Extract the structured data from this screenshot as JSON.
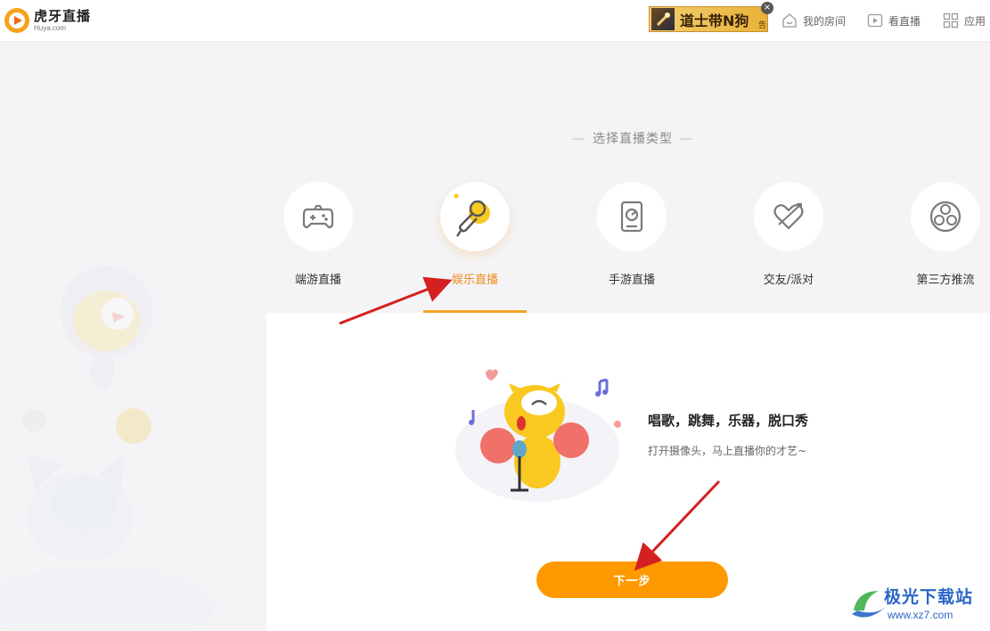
{
  "app": {
    "logo_cn": "虎牙直播",
    "logo_en": "Huya.com"
  },
  "header": {
    "ad_text": "道士带N狗",
    "ad_tag": "告",
    "ad_close": "×",
    "nav": [
      {
        "label": "我的房间",
        "icon": "house-icon"
      },
      {
        "label": "看直播",
        "icon": "play-icon"
      },
      {
        "label": "应用",
        "icon": "apps-grid-icon"
      }
    ]
  },
  "section": {
    "title": "选择直播类型"
  },
  "categories": [
    {
      "label": "端游直播",
      "icon": "gamepad-icon",
      "selected": false
    },
    {
      "label": "娱乐直播",
      "icon": "microphone-icon",
      "selected": true
    },
    {
      "label": "手游直播",
      "icon": "mobile-game-icon",
      "selected": false
    },
    {
      "label": "交友/派对",
      "icon": "heart-arrow-icon",
      "selected": false
    },
    {
      "label": "第三方推流",
      "icon": "obs-icon",
      "selected": false
    }
  ],
  "detail": {
    "title": "唱歌，跳舞，乐器，脱口秀",
    "subtitle": "打开摄像头，马上直播你的才艺~"
  },
  "actions": {
    "next_label": "下一步"
  },
  "watermark": {
    "cn": "极光下载站",
    "en": "www.xz7.com"
  },
  "colors": {
    "accent": "#fe9a00",
    "active_text": "#f08a1c",
    "annotation_arrow": "#d42020"
  }
}
